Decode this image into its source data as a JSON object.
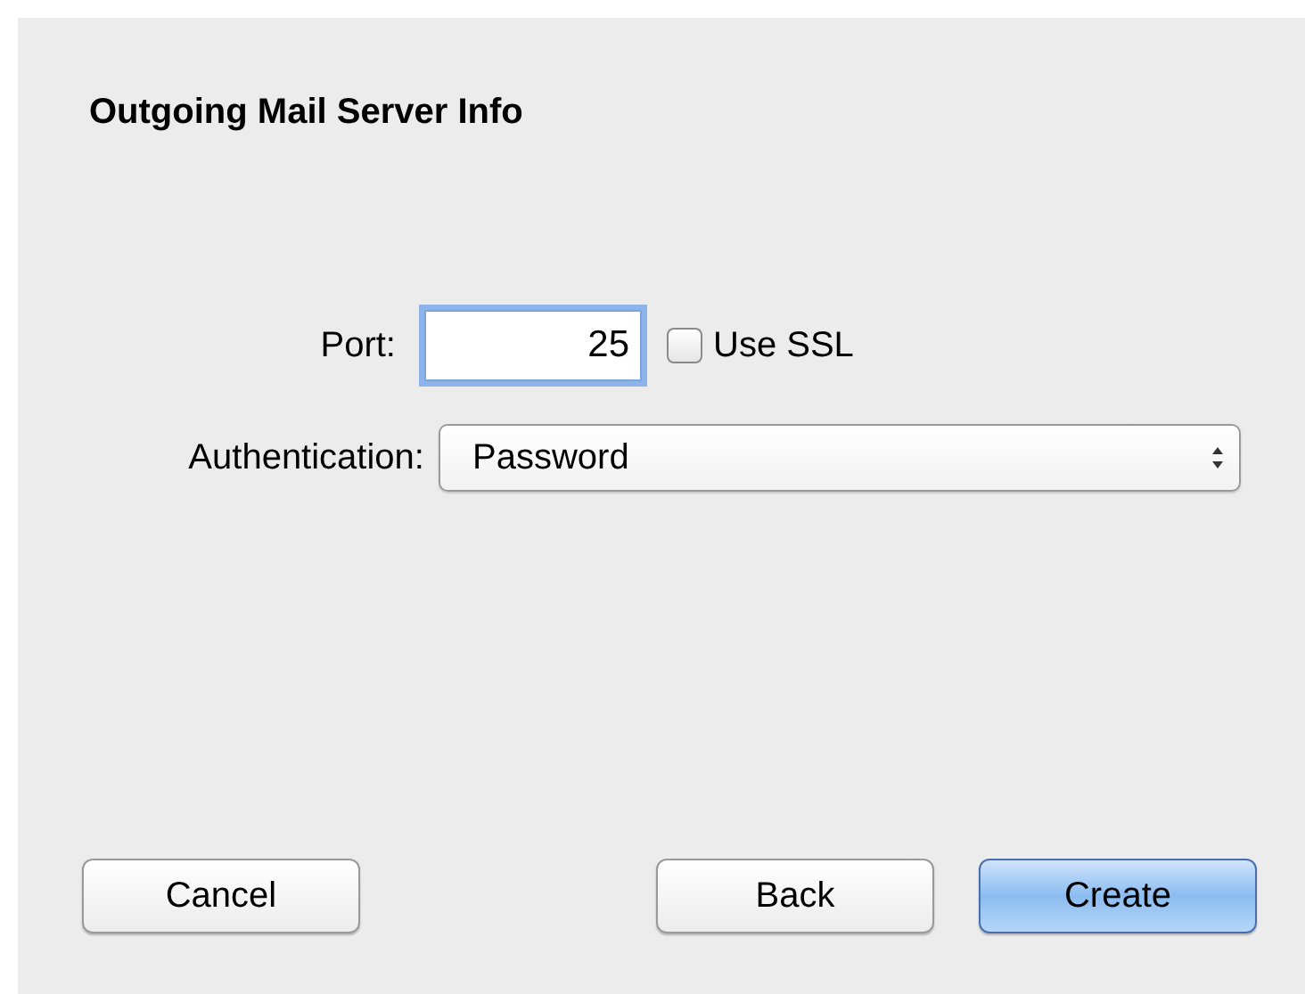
{
  "title": "Outgoing Mail Server Info",
  "port": {
    "label": "Port:",
    "value": "25",
    "focused": true
  },
  "ssl": {
    "label": "Use SSL",
    "checked": false
  },
  "authentication": {
    "label": "Authentication:",
    "value": "Password"
  },
  "buttons": [
    {
      "label": "Cancel",
      "default": false
    },
    {
      "label": "Back",
      "default": false
    },
    {
      "label": "Create",
      "default": true
    }
  ]
}
